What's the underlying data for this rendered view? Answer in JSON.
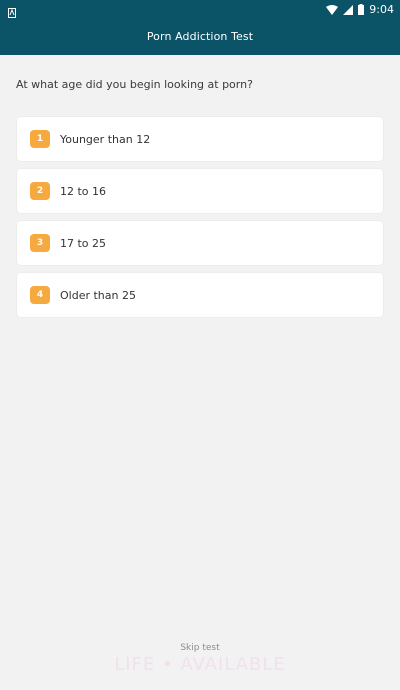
{
  "status_bar": {
    "time": "9:04"
  },
  "header": {
    "title": "Porn Addiction Test"
  },
  "question": {
    "text": "At what age did you begin looking at porn?"
  },
  "options": [
    {
      "number": "1",
      "label": "Younger than 12"
    },
    {
      "number": "2",
      "label": "12 to 16"
    },
    {
      "number": "3",
      "label": "17 to 25"
    },
    {
      "number": "4",
      "label": "Older than 25"
    }
  ],
  "footer": {
    "skip_label": "Skip test",
    "watermark": "LIFE • AVAILABLE"
  },
  "colors": {
    "header_bg": "#0b5468",
    "badge": "#f5a93f",
    "page_bg": "#f2f2f2"
  }
}
